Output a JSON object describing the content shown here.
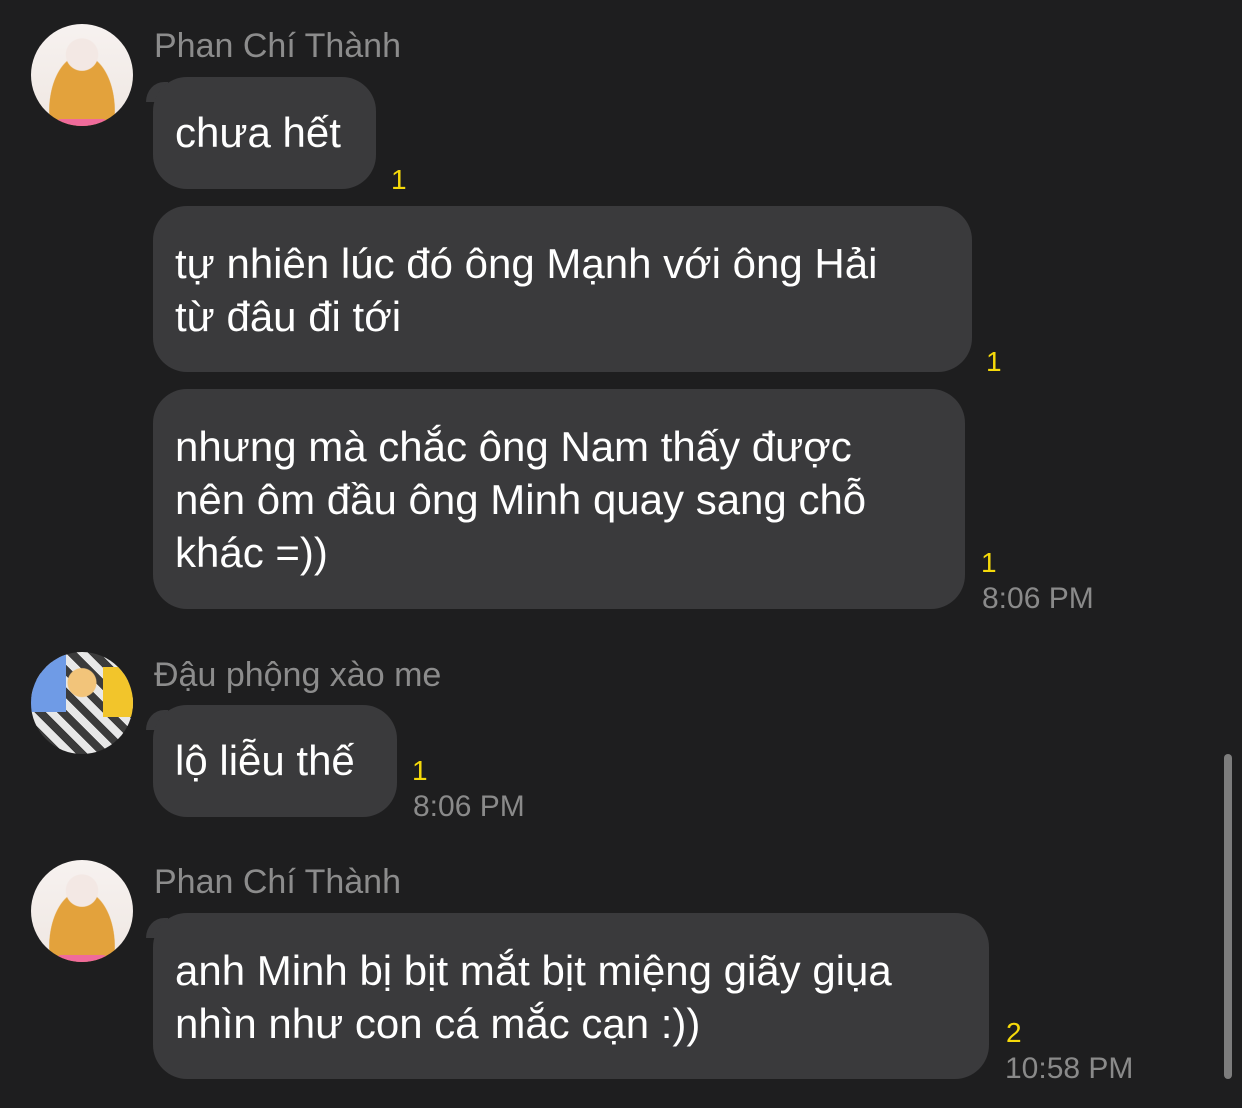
{
  "messages": [
    {
      "sender": "Phan Chí Thành",
      "bubbles": [
        {
          "text": "chưa hết",
          "read_count": "1"
        },
        {
          "text": "tự nhiên lúc đó ông Mạnh với ông Hải\ntừ đâu đi tới",
          "read_count": "1"
        },
        {
          "text": "nhưng mà chắc ông Nam thấy được\nnên ôm đầu ông Minh quay sang chỗ\nkhác =))",
          "read_count": "1",
          "time": "8:06 PM"
        }
      ]
    },
    {
      "sender": "Đậu phộng xào me",
      "bubbles": [
        {
          "text": "lộ liễu thế",
          "read_count": "1",
          "time": "8:06 PM"
        }
      ]
    },
    {
      "sender": "Phan Chí Thành",
      "bubbles": [
        {
          "text": "anh Minh bị bịt mắt bịt miệng giãy giụa\nnhìn như con cá mắc cạn :))",
          "read_count": "2",
          "time": "10:58 PM"
        }
      ]
    }
  ],
  "colors": {
    "background": "#1e1e1f",
    "bubble": "#3a3a3c",
    "read_badge": "#f5d90a",
    "sender_text": "#8c8c8c"
  }
}
